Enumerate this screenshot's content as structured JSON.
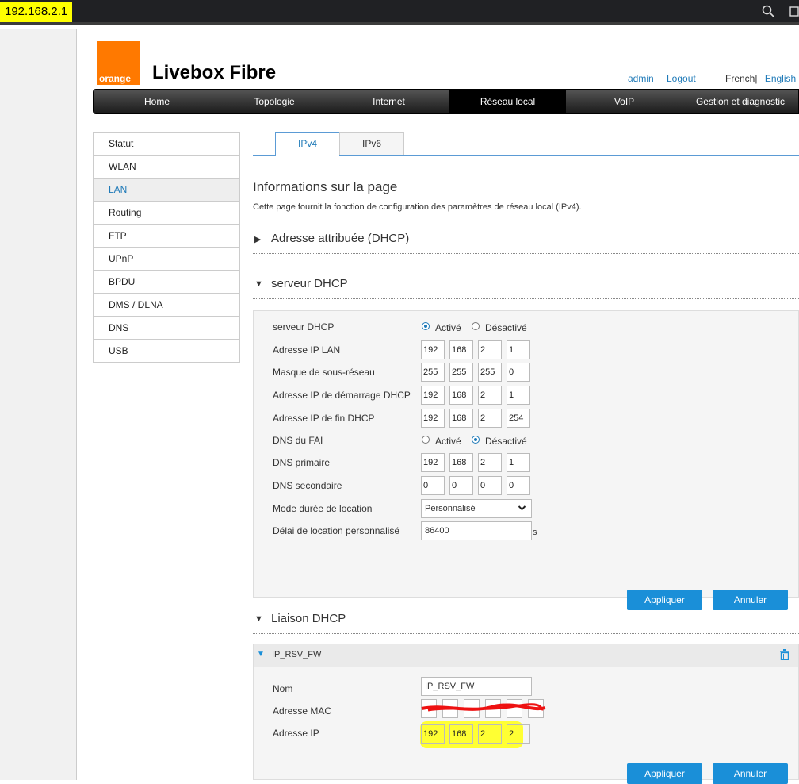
{
  "browser": {
    "url": "192.168.2.1",
    "icons": [
      "zoom-icon",
      "install-icon"
    ]
  },
  "header": {
    "logo_text": "orange",
    "brand": "Livebox Fibre",
    "links": {
      "admin": "admin",
      "logout": "Logout",
      "lang_french": "French",
      "lang_sep": "|",
      "lang_english": "English"
    }
  },
  "nav": {
    "tabs": [
      {
        "label": "Home"
      },
      {
        "label": "Topologie"
      },
      {
        "label": "Internet"
      },
      {
        "label": "Réseau local"
      },
      {
        "label": "VoIP"
      },
      {
        "label": "Gestion et diagnostic"
      }
    ],
    "active": "Réseau local"
  },
  "sidebar": {
    "items": [
      {
        "label": "Statut"
      },
      {
        "label": "WLAN"
      },
      {
        "label": "LAN"
      },
      {
        "label": "Routing"
      },
      {
        "label": "FTP"
      },
      {
        "label": "UPnP"
      },
      {
        "label": "BPDU"
      },
      {
        "label": "DMS / DLNA"
      },
      {
        "label": "DNS"
      },
      {
        "label": "USB"
      }
    ],
    "active": "LAN"
  },
  "page_tabs": [
    {
      "label": "IPv4"
    },
    {
      "label": "IPv6"
    }
  ],
  "info": {
    "title": "Informations sur la page",
    "desc": "Cette page fournit la fonction de configuration des paramètres de réseau local (IPv4)."
  },
  "sections": {
    "assigned": "Adresse attribuée (DHCP)",
    "server": "serveur DHCP",
    "binding": "Liaison DHCP"
  },
  "dhcp_server": {
    "server_label": "serveur DHCP",
    "opt_active": "Activé",
    "opt_inactive": "Désactivé",
    "lan_ip_label": "Adresse IP LAN",
    "lan_ip": [
      "192",
      "168",
      "2",
      "1"
    ],
    "mask_label": "Masque de sous-réseau",
    "mask": [
      "255",
      "255",
      "255",
      "0"
    ],
    "start_label": "Adresse IP de démarrage DHCP",
    "start_ip": [
      "192",
      "168",
      "2",
      "1"
    ],
    "end_label": "Adresse IP de fin DHCP",
    "end_ip": [
      "192",
      "168",
      "2",
      "254"
    ],
    "dns_isp_label": "DNS du FAI",
    "dns1_label": "DNS primaire",
    "dns1": [
      "192",
      "168",
      "2",
      "1"
    ],
    "dns2_label": "DNS secondaire",
    "dns2": [
      "0",
      "0",
      "0",
      "0"
    ],
    "lease_mode_label": "Mode durée de location",
    "lease_mode": "Personnalisé",
    "lease_time_label": "Délai de location personnalisé",
    "lease_time": "86400",
    "lease_unit": "s",
    "apply": "Appliquer",
    "cancel": "Annuler"
  },
  "binding": {
    "entry_name": "IP_RSV_FW",
    "name_label": "Nom",
    "name_value": "IP_RSV_FW",
    "mac_label": "Adresse MAC",
    "ip_label": "Adresse IP",
    "ip": [
      "192",
      "168",
      "2",
      "2"
    ],
    "apply": "Appliquer",
    "cancel": "Annuler"
  }
}
